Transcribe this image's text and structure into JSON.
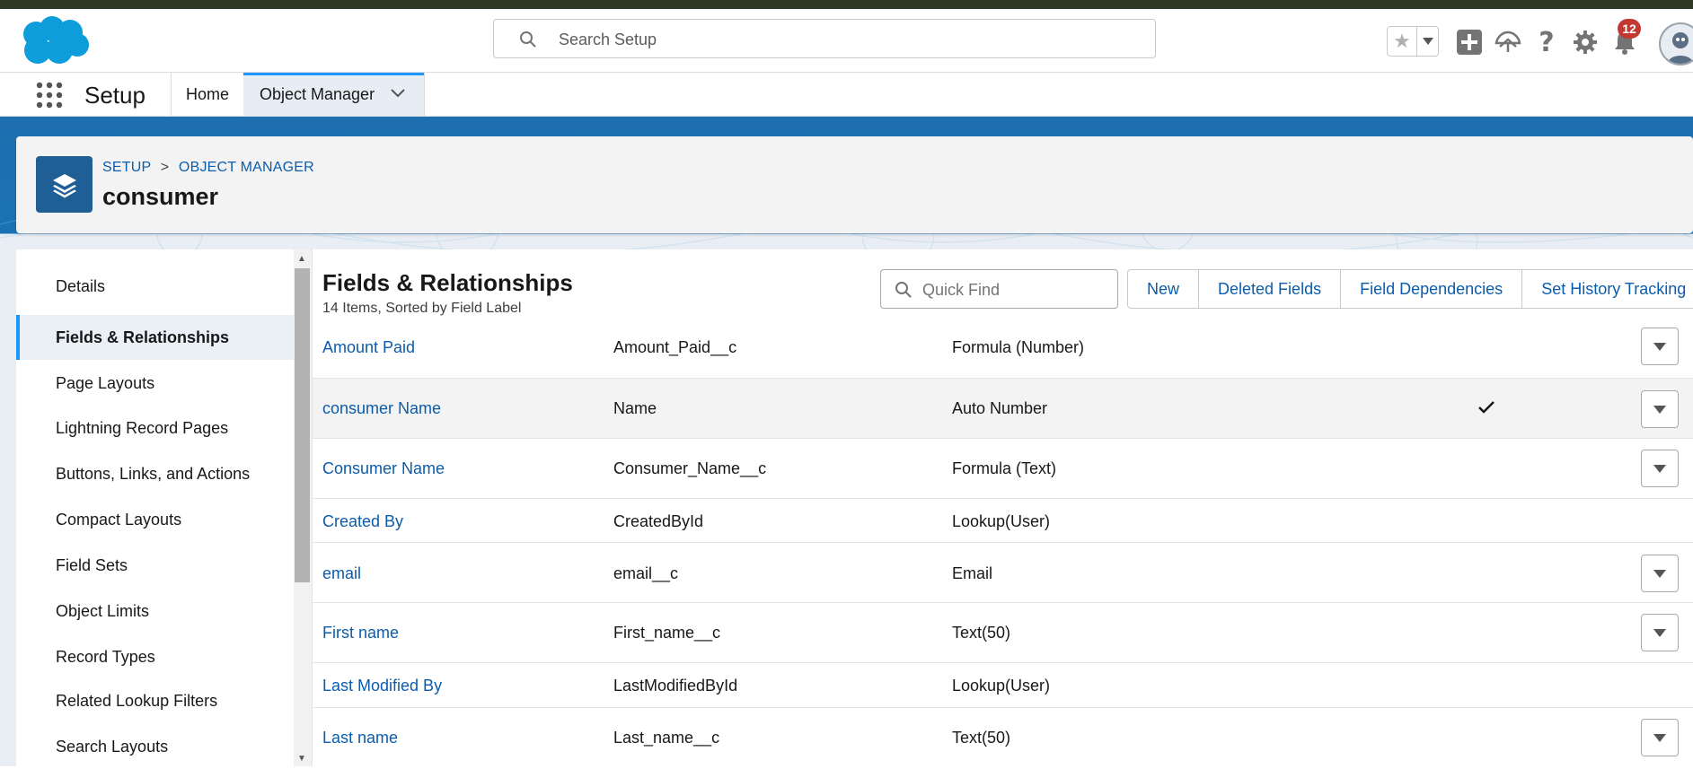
{
  "header": {
    "search_placeholder": "Search Setup",
    "notification_count": "12"
  },
  "app_nav": {
    "app_name": "Setup",
    "tabs": [
      {
        "label": "Home"
      },
      {
        "label": "Object Manager"
      }
    ]
  },
  "object_header": {
    "breadcrumb": [
      "SETUP",
      "OBJECT MANAGER"
    ],
    "breadcrumb_separator": ">",
    "title": "consumer"
  },
  "sidebar": {
    "items": [
      {
        "label": "Details"
      },
      {
        "label": "Fields & Relationships"
      },
      {
        "label": "Page Layouts"
      },
      {
        "label": "Lightning Record Pages"
      },
      {
        "label": "Buttons, Links, and Actions"
      },
      {
        "label": "Compact Layouts"
      },
      {
        "label": "Field Sets"
      },
      {
        "label": "Object Limits"
      },
      {
        "label": "Record Types"
      },
      {
        "label": "Related Lookup Filters"
      },
      {
        "label": "Search Layouts"
      }
    ],
    "active": "Fields & Relationships"
  },
  "main": {
    "title": "Fields & Relationships",
    "subtitle": "14 Items, Sorted by Field Label",
    "quick_find_placeholder": "Quick Find",
    "buttons": [
      "New",
      "Deleted Fields",
      "Field Dependencies",
      "Set History Tracking"
    ],
    "rows": [
      {
        "label": "Amount Paid",
        "api_name": "Amount_Paid__c",
        "type": "Formula (Number)",
        "indexed": false,
        "has_menu": true
      },
      {
        "label": "consumer Name",
        "api_name": "Name",
        "type": "Auto Number",
        "indexed": true,
        "has_menu": true
      },
      {
        "label": "Consumer Name",
        "api_name": "Consumer_Name__c",
        "type": "Formula (Text)",
        "indexed": false,
        "has_menu": true
      },
      {
        "label": "Created By",
        "api_name": "CreatedById",
        "type": "Lookup(User)",
        "indexed": false,
        "has_menu": false
      },
      {
        "label": "email",
        "api_name": "email__c",
        "type": "Email",
        "indexed": false,
        "has_menu": true
      },
      {
        "label": "First name",
        "api_name": "First_name__c",
        "type": "Text(50)",
        "indexed": false,
        "has_menu": true
      },
      {
        "label": "Last Modified By",
        "api_name": "LastModifiedById",
        "type": "Lookup(User)",
        "indexed": false,
        "has_menu": false
      },
      {
        "label": "Last name",
        "api_name": "Last_name__c",
        "type": "Text(50)",
        "indexed": false,
        "has_menu": true
      }
    ]
  },
  "colors": {
    "brand_blue": "#0b5cab",
    "active_accent": "#1b96ff",
    "object_icon": "#1f5f96",
    "badge": "#c23934"
  }
}
